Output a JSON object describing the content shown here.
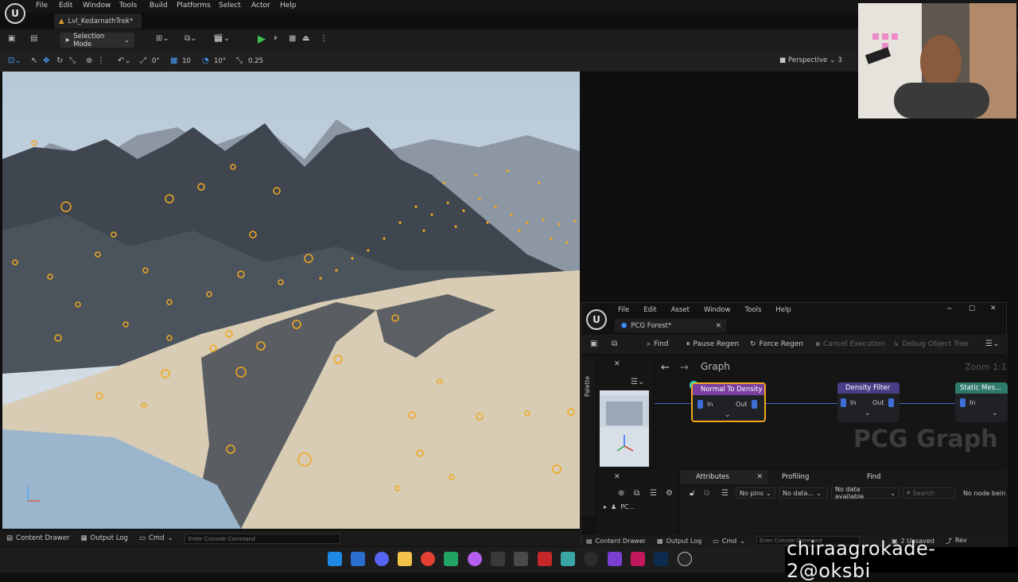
{
  "menubar": {
    "items": [
      "File",
      "Edit",
      "Window",
      "Tools",
      "Build",
      "Platforms",
      "Select",
      "Actor",
      "Help"
    ]
  },
  "level_tab": {
    "label": "Lvl_KedarnathTrek*"
  },
  "toolbar": {
    "selection_mode": "Selection Mode"
  },
  "viewport_toolbar": {
    "snap_angle": "0°",
    "grid_snap": "10",
    "rot_snap": "10°",
    "scale_snap": "0.25",
    "view_mode": "Perspective",
    "extra": "3"
  },
  "bottombar": {
    "content_drawer": "Content Drawer",
    "output_log": "Output Log",
    "cmd": "Cmd",
    "console_placeholder": "Enter Console Command"
  },
  "pcg": {
    "menu": [
      "File",
      "Edit",
      "Asset",
      "Window",
      "Tools",
      "Help"
    ],
    "tab": "PCG Forest*",
    "toolbar": {
      "find": "Find",
      "pause": "Pause Regen",
      "force": "Force Regen",
      "cancel": "Cancel Execution",
      "debug": "Debug Object Tree"
    },
    "palette": "Palette",
    "graph_label": "Graph",
    "zoom": "Zoom 1:1",
    "watermark": "PCG Graph",
    "nodes": [
      {
        "title": "Normal To Density",
        "in": "In",
        "out": "Out",
        "color": "#7b3fa0"
      },
      {
        "title": "Density Filter",
        "in": "In",
        "out": "Out",
        "color": "#4a3c86"
      },
      {
        "title": "Static Mes...",
        "in": "In",
        "color": "#2f7a6a"
      }
    ],
    "tree_item": "PC...",
    "panel_tabs": {
      "attributes": "Attributes",
      "profiling": "Profiling",
      "find": "Find"
    },
    "filters": {
      "pins": "No pins",
      "data": "No data...",
      "available": "No data available",
      "search": "Search",
      "no_node": "No node bein"
    },
    "bottom": {
      "content_drawer": "Content Drawer",
      "output_log": "Output Log",
      "cmd": "Cmd",
      "console_placeholder": "Enter Console Command",
      "unsaved": "2 Unsaved",
      "rev": "Rev"
    }
  },
  "overlay_text": "chiraagrokade-2@oksbi",
  "colors": {
    "accent": "#f0a81e",
    "play": "#3ec24a",
    "selected": "#f0a81e"
  }
}
